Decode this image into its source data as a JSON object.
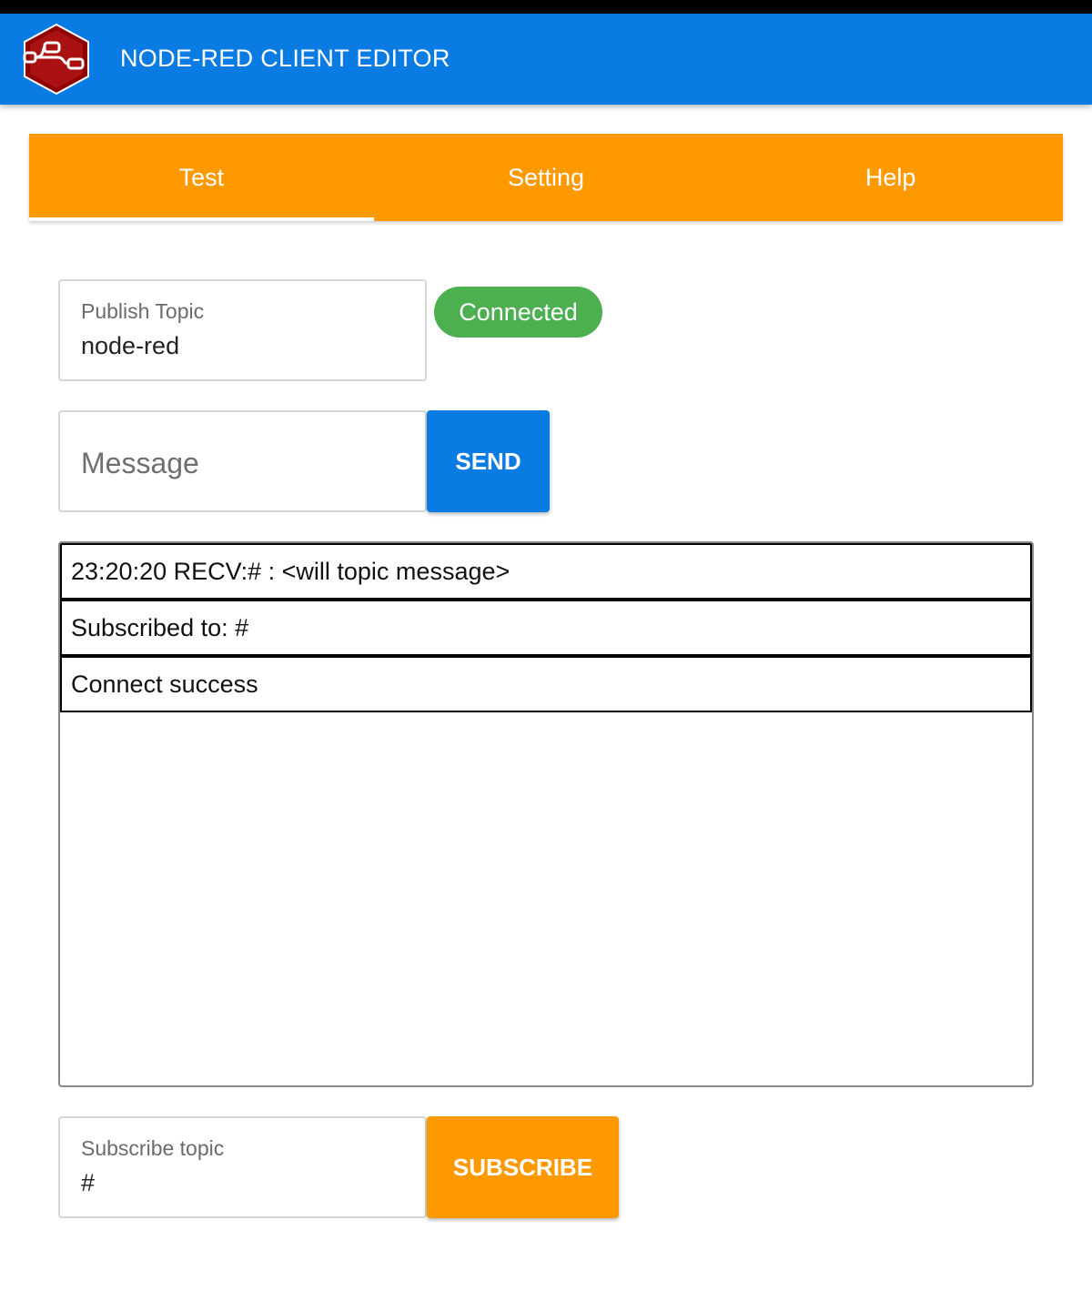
{
  "app_bar": {
    "title": "NODE-RED CLIENT EDITOR",
    "logo_icon": "node-red-logo-icon",
    "color": "#0a7be3"
  },
  "tabs": [
    {
      "label": "Test",
      "active": true
    },
    {
      "label": "Setting",
      "active": false
    },
    {
      "label": "Help",
      "active": false
    }
  ],
  "tab_color": "#fe9900",
  "publish": {
    "label": "Publish Topic",
    "value": "node-red"
  },
  "status": {
    "text": "Connected",
    "color": "#4caf50"
  },
  "message": {
    "placeholder": "Message",
    "send_label": "SEND"
  },
  "log": [
    "23:20:20 RECV:# : <will topic message>",
    "Subscribed to: #",
    "Connect success"
  ],
  "subscribe": {
    "label": "Subscribe topic",
    "value": "#",
    "button_label": "SUBSCRIBE"
  }
}
